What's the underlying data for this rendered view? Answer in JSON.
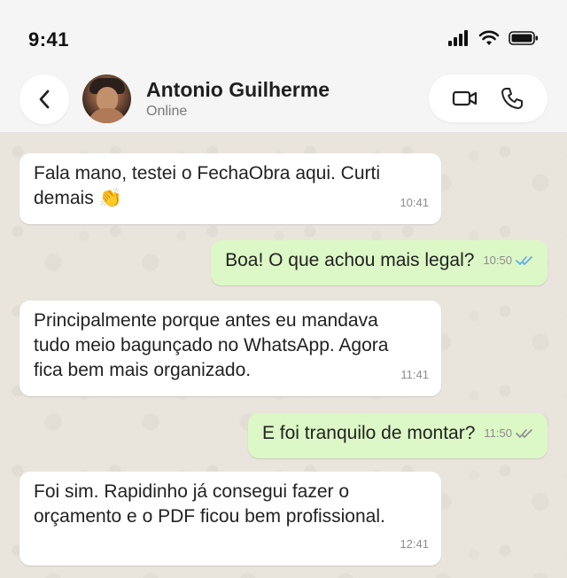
{
  "status_bar": {
    "time": "9:41"
  },
  "header": {
    "back_icon": "chevron-left-icon",
    "contact_name": "Antonio Guilherme",
    "contact_status": "Online",
    "video_icon": "video-camera-icon",
    "phone_icon": "phone-icon"
  },
  "messages": [
    {
      "direction": "incoming",
      "text": "Fala mano, testei o FechaObra aqui. Curti demais 👏",
      "time": "10:41"
    },
    {
      "direction": "outgoing",
      "text": "Boa! O que achou mais legal?",
      "time": "10:50",
      "status": "read"
    },
    {
      "direction": "incoming",
      "text": "Principalmente porque antes eu mandava tudo meio bagunçado no WhatsApp. Agora fica bem mais organizado.",
      "time": "11:41"
    },
    {
      "direction": "outgoing",
      "text": "E foi tranquilo de montar?",
      "time": "11:50",
      "status": "delivered"
    },
    {
      "direction": "incoming",
      "text": "Foi sim. Rapidinho já consegui fazer o orçamento e o PDF ficou bem profissional.",
      "time": "12:41"
    }
  ],
  "colors": {
    "incoming_bubble": "#ffffff",
    "outgoing_bubble": "#dcf8c6",
    "read_tick": "#5aa9e6",
    "delivered_tick": "#8c8c8c",
    "chat_background": "#e9e4dc"
  }
}
